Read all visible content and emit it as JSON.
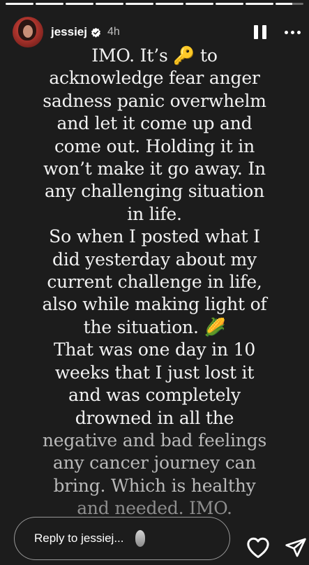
{
  "story": {
    "username": "jessiej",
    "time_ago": "4h",
    "progress": [
      1,
      1,
      1,
      1,
      1,
      1,
      1,
      1,
      1,
      0.6
    ],
    "text_lines": [
      {
        "text": "IMO. It’s 🔑 to",
        "tone": "normal"
      },
      {
        "text": "acknowledge fear anger",
        "tone": "normal"
      },
      {
        "text": "sadness panic overwhelm",
        "tone": "normal"
      },
      {
        "text": "and let it come up and",
        "tone": "normal"
      },
      {
        "text": "come out. Holding it in",
        "tone": "normal"
      },
      {
        "text": "won’t make it go away. In",
        "tone": "normal"
      },
      {
        "text": "any challenging situation",
        "tone": "normal"
      },
      {
        "text": "in life.",
        "tone": "normal"
      },
      {
        "text": "So when I posted what I",
        "tone": "normal"
      },
      {
        "text": "did yesterday about my",
        "tone": "normal"
      },
      {
        "text": "current challenge in life,",
        "tone": "normal"
      },
      {
        "text": "also while making light of",
        "tone": "normal"
      },
      {
        "text": "the situation. 🌽",
        "tone": "normal"
      },
      {
        "text": "That was one day in 10",
        "tone": "normal"
      },
      {
        "text": "weeks that I just lost it",
        "tone": "normal"
      },
      {
        "text": "and was completely",
        "tone": "normal"
      },
      {
        "text": "drowned in all the",
        "tone": "normal"
      },
      {
        "text": "negative and bad feelings",
        "tone": "dim"
      },
      {
        "text": "any cancer journey can",
        "tone": "dim"
      },
      {
        "text": "bring. Which is healthy",
        "tone": "dim"
      },
      {
        "text": "and needed. IMO.",
        "tone": "faded"
      }
    ]
  },
  "reply": {
    "placeholder": "Reply to jessiej...",
    "emoji_icon": "egg-icon"
  },
  "icons": {
    "verified": "verified-badge-icon",
    "pause": "pause-icon",
    "more": "more-options-icon",
    "like": "heart-icon",
    "share": "send-icon"
  },
  "colors": {
    "background": "#1c1c1c",
    "text": "#f2f2f2",
    "verified": "#3897f0"
  }
}
